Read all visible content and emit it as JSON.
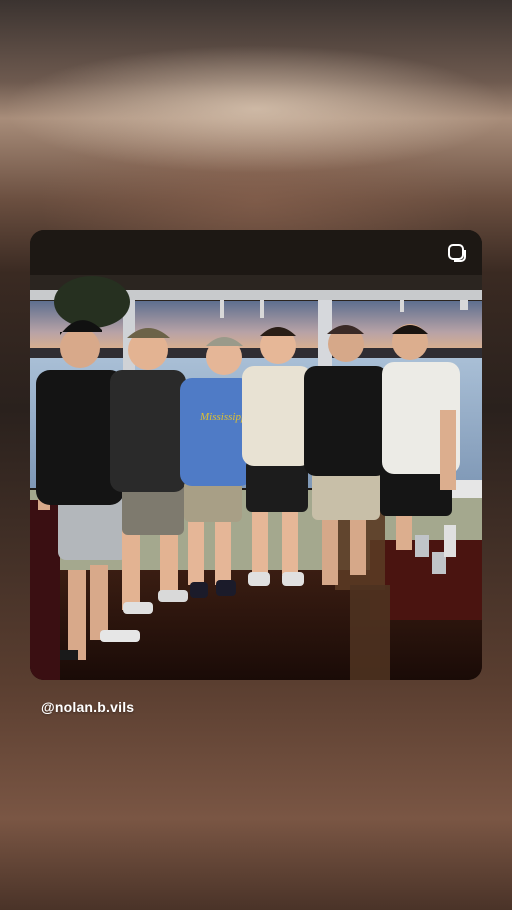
{
  "story": {
    "mention": "@nolan.b.vils"
  },
  "photo": {
    "people_count": 6
  },
  "icons": {
    "expand": "expand-icon"
  },
  "colors": {
    "background": "#3a2a22",
    "mention_text": "#ffffff"
  }
}
